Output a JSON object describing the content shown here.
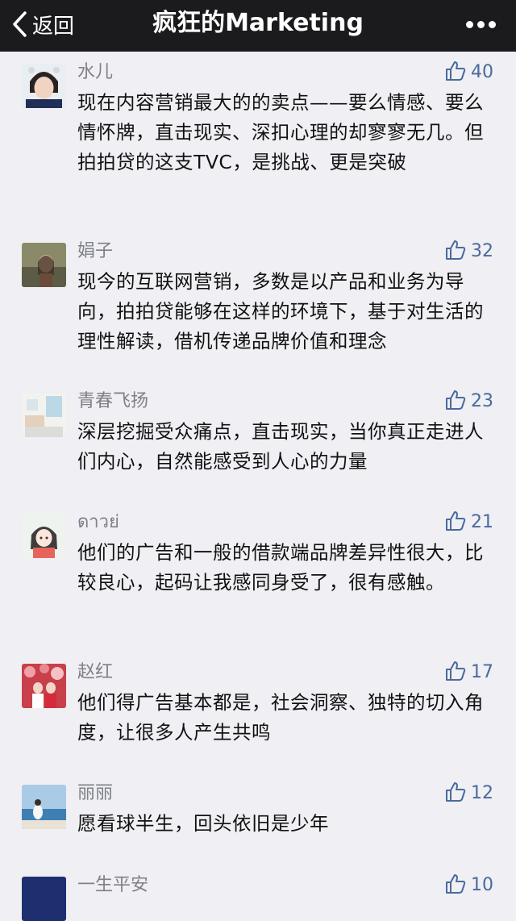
{
  "header": {
    "back_label": "返回",
    "title": "疯狂的Marketing"
  },
  "colors": {
    "header_bg": "#1b1b1e",
    "background": "#efeff4",
    "like_color": "#4a6a9c",
    "name_color": "#7f8088"
  },
  "comments": [
    {
      "name": "水儿",
      "likes": "40",
      "text": "现在内容营销最大的的卖点——要么情感、要么情怀牌，直击现实、深扣心理的却寥寥无几。但拍拍贷的这支TVC，是挑战、更是突破"
    },
    {
      "name": "娟子",
      "likes": "32",
      "text": "现今的互联网营销，多数是以产品和业务为导向，拍拍贷能够在这样的环境下，基于对生活的理性解读，借机传递品牌价值和理念"
    },
    {
      "name": "青春飞扬",
      "likes": "23",
      "text": "深层挖掘受众痛点，直击现实，当你真正走进人们内心，自然能感受到人心的力量"
    },
    {
      "name": "ดาวย่",
      "likes": "21",
      "text": "他们的广告和一般的借款端品牌差异性很大，比较良心，起码让我感同身受了，很有感触。"
    },
    {
      "name": "赵红",
      "likes": "17",
      "text": "他们得广告基本都是，社会洞察、独特的切入角度，让很多人产生共鸣"
    },
    {
      "name": "丽丽",
      "likes": "12",
      "text": "愿看球半生，回头依旧是少年"
    },
    {
      "name": "一生平安",
      "likes": "10",
      "text": ""
    }
  ]
}
